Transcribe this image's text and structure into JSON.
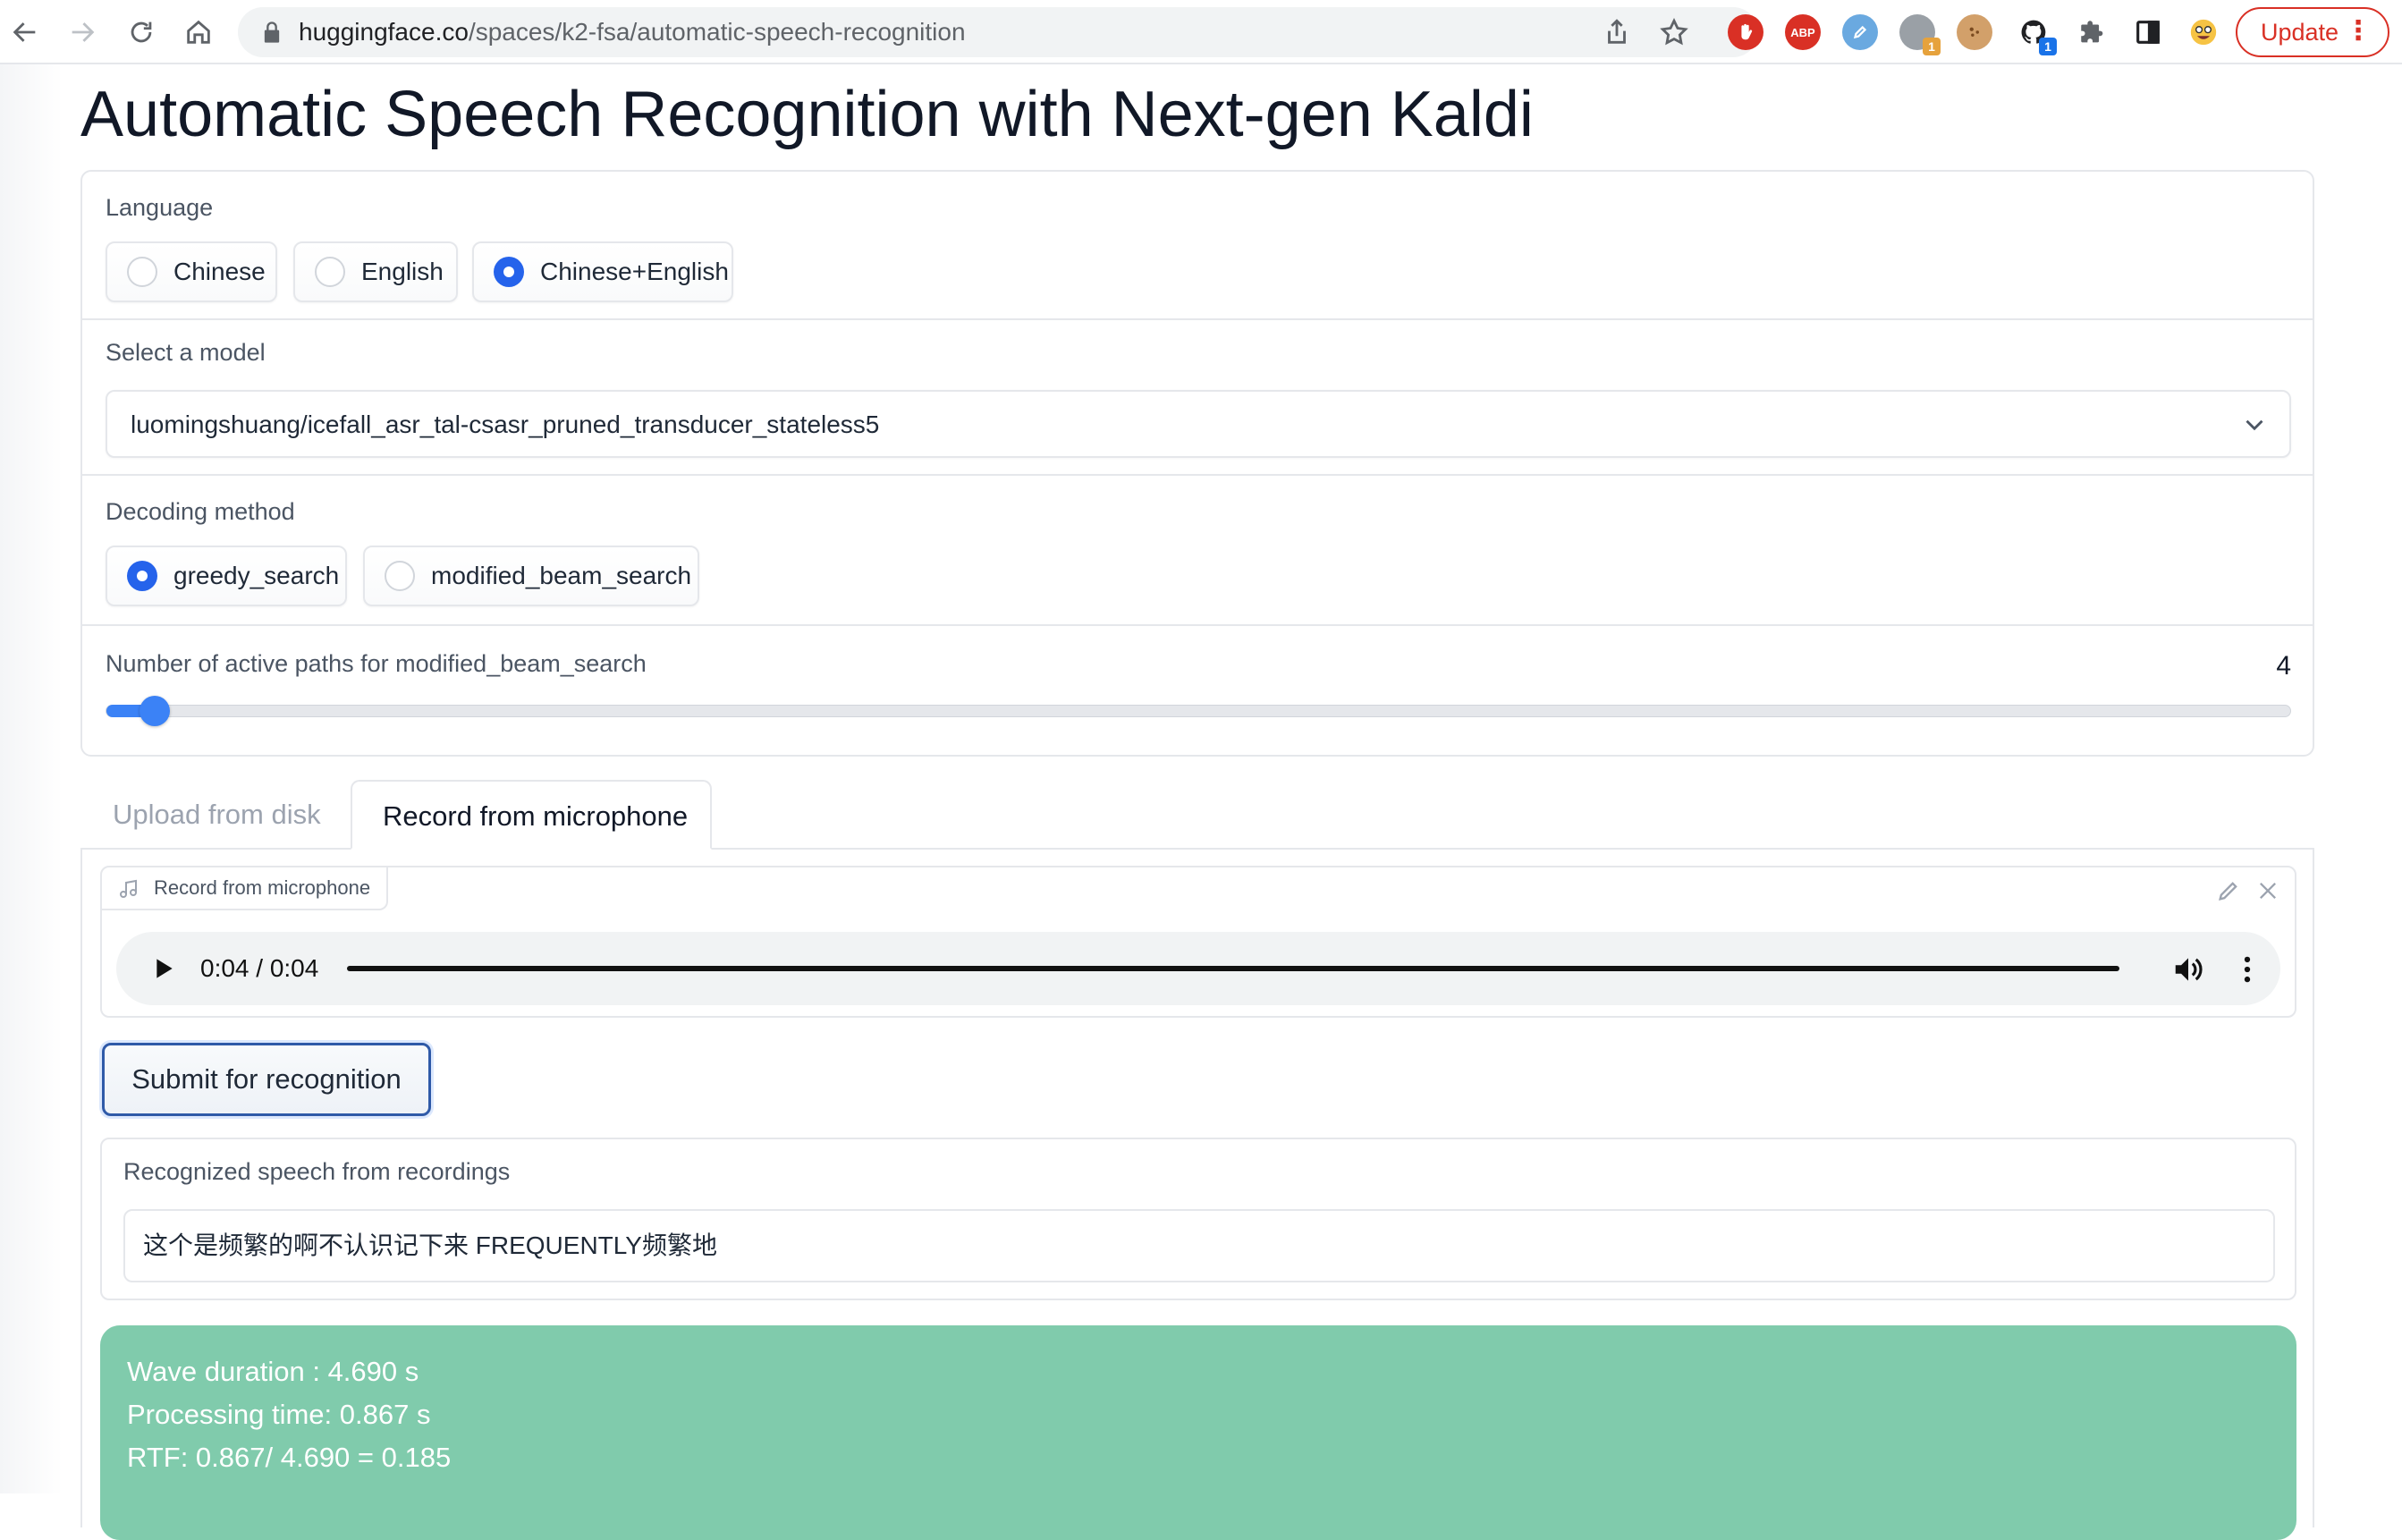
{
  "browser": {
    "url_host": "huggingface.co",
    "url_path": "/spaces/k2-fsa/automatic-speech-recognition",
    "extensions": [
      {
        "name": "ublock-icon",
        "color": "#d93025",
        "text": ""
      },
      {
        "name": "adblock-plus-icon",
        "color": "#d93025",
        "text": "ABP"
      },
      {
        "name": "extension-blue-icon",
        "color": "#6aa9e0",
        "text": ""
      },
      {
        "name": "extension-gray-icon",
        "color": "#9aa0a6",
        "text": "",
        "badge": "1",
        "badge_color": "#e6a23c"
      },
      {
        "name": "cookie-icon",
        "color": "#d2a06a",
        "text": ""
      },
      {
        "name": "github-icon",
        "color": "#202124",
        "text": "",
        "badge": "1",
        "badge_color": "#1a73e8"
      }
    ],
    "update_label": "Update"
  },
  "page": {
    "title": "Automatic Speech Recognition with Next-gen Kaldi"
  },
  "language": {
    "label": "Language",
    "options": [
      "Chinese",
      "English",
      "Chinese+English"
    ],
    "selected": "Chinese+English"
  },
  "model": {
    "label": "Select a model",
    "value": "luomingshuang/icefall_asr_tal-csasr_pruned_transducer_stateless5"
  },
  "decoding": {
    "label": "Decoding method",
    "options": [
      "greedy_search",
      "modified_beam_search"
    ],
    "selected": "greedy_search"
  },
  "active_paths": {
    "label": "Number of active paths for modified_beam_search",
    "value": "4",
    "fraction": 0.022
  },
  "tabs": {
    "upload": "Upload from disk",
    "record": "Record from microphone",
    "active": "record"
  },
  "audio": {
    "label": "Record from microphone",
    "time": "0:04 / 0:04",
    "progress_fraction": 1.0
  },
  "submit_label": "Submit for recognition",
  "result": {
    "label": "Recognized speech from recordings",
    "text": "这个是频繁的啊不认识记下来 FREQUENTLY频繁地"
  },
  "info": {
    "wave_duration": "Wave duration : 4.690 s",
    "processing_time": "Processing time: 0.867 s",
    "rtf": "RTF: 0.867/ 4.690 = 0.185"
  },
  "colors": {
    "accent": "#3b82f6",
    "info_bg": "#80cbac",
    "update_red": "#d93025"
  }
}
